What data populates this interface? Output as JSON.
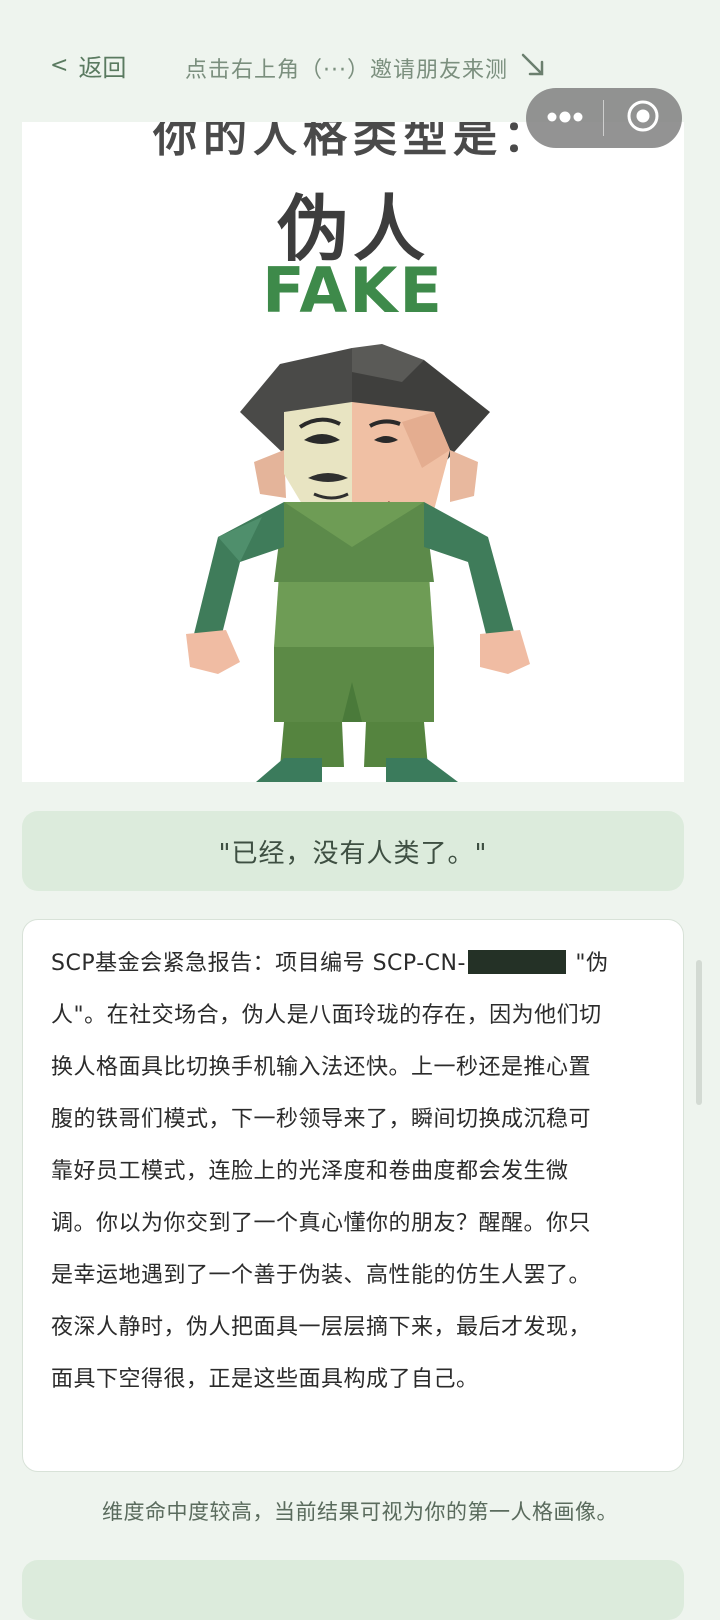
{
  "nav": {
    "back_chevron": "<",
    "back_label": "返回",
    "invite_text": "点击右上角（···）邀请朋友来测",
    "invite_arrow_icon": "arrow-down-right-icon"
  },
  "capsule": {
    "more_icon": "more-dots-icon",
    "close_icon": "target-close-icon"
  },
  "result": {
    "cut_title": "你的人格类型是：",
    "type_cn": "伪人",
    "type_en": "FAKE",
    "figure_icon": "half-mask-figure-icon",
    "quote": "\"已经，没有人类了。\""
  },
  "report": {
    "part1": "SCP基金会紧急报告：项目编号 SCP-CN-",
    "part2": " \"伪人\"。在社交场合，伪人是八面玲珑的存在，因为他们切换人格面具比切换手机输入法还快。上一秒还是推心置腹的铁哥们模式，下一秒领导来了，瞬间切换成沉稳可靠好员工模式，连脸上的光泽度和卷曲度都会发生微调。你以为你交到了一个真心懂你的朋友？醒醒。你只是幸运地遇到了一个善于伪装、高性能的仿生人罢了。夜深人静时，伪人把面具一层层摘下来，最后才发现，面具下空得很，正是这些面具构成了自己。"
  },
  "note": "维度命中度较高，当前结果可视为你的第一人格画像。",
  "colors": {
    "background": "#eef4ee",
    "accent_green": "#3e8a4a",
    "quote_bg": "#dcebdc"
  }
}
